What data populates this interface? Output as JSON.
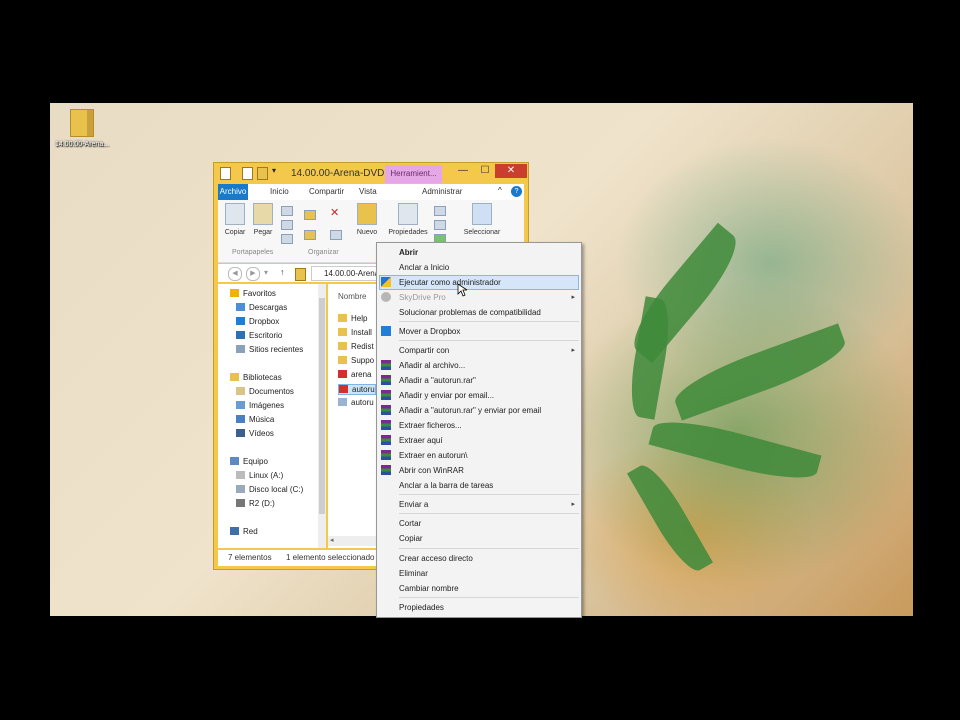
{
  "desktop": {
    "icon_label": "14.00.00-Arena..."
  },
  "window": {
    "title": "14.00.00-Arena-DVD",
    "context_tab": "Herramient...",
    "controls": {
      "minimize": "—",
      "maximize": "☐",
      "close": "✕"
    },
    "tabs": [
      "Archivo",
      "Inicio",
      "Compartir",
      "Vista",
      "Administrar"
    ],
    "ribbon": {
      "copiar": "Copiar",
      "pegar": "Pegar",
      "nuevo": "Nuevo",
      "propiedades": "Propiedades",
      "seleccionar": "Seleccionar",
      "group_portapapeles": "Portapapeles",
      "group_organizar": "Organizar"
    },
    "address_path": "14.00.00-Arena-D",
    "nav": {
      "favoritos": "Favoritos",
      "descargas": "Descargas",
      "dropbox": "Dropbox",
      "escritorio": "Escritorio",
      "sitios": "Sitios recientes",
      "bibliotecas": "Bibliotecas",
      "documentos": "Documentos",
      "imagenes": "Imágenes",
      "musica": "Música",
      "videos": "Vídeos",
      "equipo": "Equipo",
      "linux": "Linux (A:)",
      "disco": "Disco local (C:)",
      "r2": "R2 (D:)",
      "red": "Red"
    },
    "files_header": "Nombre",
    "files": [
      "Help",
      "Install",
      "Redist",
      "Suppo",
      "arena",
      "autoru",
      "autoru"
    ],
    "status": {
      "count": "7 elementos",
      "selected": "1 elemento seleccionado"
    }
  },
  "menu": {
    "abrir": "Abrir",
    "anclar_inicio": "Anclar a Inicio",
    "ejecutar_admin": "Ejecutar como administrador",
    "skydrive": "SkyDrive Pro",
    "solucionar": "Solucionar problemas de compatibilidad",
    "dropbox": "Mover a Dropbox",
    "compartir": "Compartir con",
    "anadir_archivo": "Añadir al archivo...",
    "anadir_rar": "Añadir a \"autorun.rar\"",
    "anadir_email": "Añadir y enviar por email...",
    "anadir_rar_email": "Añadir a \"autorun.rar\" y enviar por email",
    "extraer_ficheros": "Extraer ficheros...",
    "extraer_aqui": "Extraer aquí",
    "extraer_en": "Extraer en autorun\\",
    "abrir_winrar": "Abrir con WinRAR",
    "anclar_barra": "Anclar a la barra de tareas",
    "enviar_a": "Enviar a",
    "cortar": "Cortar",
    "copiar": "Copiar",
    "acceso_directo": "Crear acceso directo",
    "eliminar": "Eliminar",
    "cambiar_nombre": "Cambiar nombre",
    "propiedades": "Propiedades",
    "submenu_arrow": "▸"
  },
  "colors": {
    "window_frame": "#f3c84b",
    "file_tab": "#1979ca",
    "context_tab": "#e6a7e6",
    "close_button": "#c93e2d",
    "menu_highlight": "#d5e6f8"
  }
}
